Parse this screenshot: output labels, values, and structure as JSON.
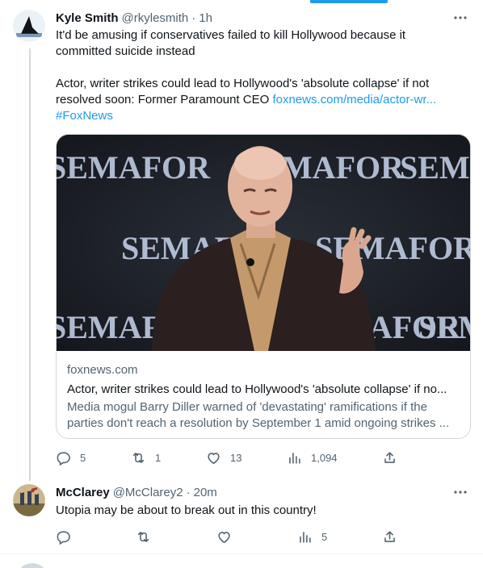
{
  "tweet1": {
    "display_name": "Kyle Smith",
    "handle": "@rkylesmith",
    "separator": "·",
    "time": "1h",
    "text_line1": "It'd be amusing if conservatives failed to kill Hollywood because it",
    "text_line2": "committed suicide instead",
    "text_line3": "Actor, writer strikes could lead to Hollywood's 'absolute collapse' if not",
    "text_line4_plain": "resolved soon: Former Paramount CEO ",
    "link": "foxnews.com/media/actor-wr...",
    "hashtag": "#FoxNews",
    "card": {
      "domain": "foxnews.com",
      "title": "Actor, writer strikes could lead to Hollywood's 'absolute collapse' if no...",
      "description": "Media mogul Barry Diller warned of 'devastating' ramifications if the parties don't reach a resolution by September 1 amid ongoing strikes ...",
      "backdrop_text": "SEMAFOR"
    },
    "replies": "5",
    "retweets": "1",
    "likes": "13",
    "views": "1,094"
  },
  "tweet2": {
    "display_name": "McClarey",
    "handle": "@McClarey2",
    "separator": "·",
    "time": "20m",
    "text": "Utopia may be about to break out in this country!",
    "views": "5"
  },
  "colors": {
    "accent": "#1d9bf0",
    "text": "#0f1419",
    "muted": "#536471",
    "border": "#cfd9de"
  },
  "icons": {
    "more": "more-horizontal-icon",
    "reply": "reply-icon",
    "retweet": "retweet-icon",
    "like": "heart-icon",
    "views": "views-icon",
    "share": "share-icon"
  }
}
